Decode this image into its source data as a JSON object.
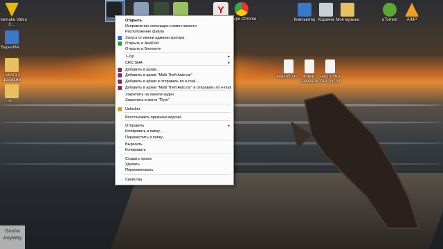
{
  "desktop_icons": [
    {
      "label": "Freemake Video C...",
      "color": "#e8b800"
    },
    {
      "label": "ВидеоМА...",
      "color": "#3a78c9"
    },
    {
      "label": "Работа с файлами",
      "color": "#e8c060"
    },
    {
      "label": "Ф...",
      "color": "#e8c060"
    }
  ],
  "top_icons": [
    {
      "label": "",
      "color": "#222222"
    },
    {
      "label": "",
      "color": "#8aa0b8"
    },
    {
      "label": "",
      "color": "#3a4a3a"
    },
    {
      "label": "",
      "color": "#9ac060"
    },
    {
      "label": "",
      "color": "#e8e8e8"
    },
    {
      "label": "Google Chrome",
      "color": "#3aa845"
    }
  ],
  "right_icons": [
    {
      "label": "Компьютер",
      "color": "#3a78c9"
    },
    {
      "label": "Корзина",
      "color": "#c8d0d8"
    },
    {
      "label": "Моя музыка",
      "color": "#e8c060"
    },
    {
      "label": "uTorrent",
      "color": "#5aa830"
    },
    {
      "label": "AIMP",
      "color": "#f0a020"
    }
  ],
  "files": [
    {
      "label": "видеоболо..."
    },
    {
      "label": "иконки с лазера.txt"
    },
    {
      "label": "настройка быстро.txt"
    }
  ],
  "context_menu": {
    "items": [
      {
        "label": "Открыть",
        "bold": true,
        "icon": "",
        "arrow": ""
      },
      {
        "label": "Исправление неполадок совместимости",
        "bold": false,
        "icon": "",
        "arrow": ""
      },
      {
        "label": "Расположение файла",
        "bold": false,
        "icon": "",
        "arrow": ""
      },
      {
        "label": "Запуск от имени администратора",
        "bold": false,
        "icon": "shield-icon",
        "arrow": ""
      },
      {
        "label": "Открыть в AkelPad",
        "bold": false,
        "icon": "akelpad-icon",
        "arrow": ""
      },
      {
        "label": "Открыть в Блокноте",
        "bold": false,
        "icon": "",
        "arrow": ""
      },
      {
        "label": "7-Zip",
        "bold": false,
        "icon": "",
        "arrow": "▸"
      },
      {
        "label": "CRC SHA",
        "bold": false,
        "icon": "",
        "arrow": "▸"
      },
      {
        "label": "Добавить в архив...",
        "bold": false,
        "icon": "winrar-icon",
        "arrow": ""
      },
      {
        "label": "Добавить в архив \"Multi Theft Auto.rar\"",
        "bold": false,
        "icon": "winrar-icon",
        "arrow": ""
      },
      {
        "label": "Добавить в архив и отправить по e-mail...",
        "bold": false,
        "icon": "winrar-icon",
        "arrow": ""
      },
      {
        "label": "Добавить в архив \"Multi Theft Auto.rar\" и отправить по e-mail",
        "bold": false,
        "icon": "winrar-icon",
        "arrow": ""
      },
      {
        "label": "Закрепить на панели задач",
        "bold": false,
        "icon": "",
        "arrow": ""
      },
      {
        "label": "Закрепить в меню \"Пуск\"",
        "bold": false,
        "icon": "",
        "arrow": ""
      },
      {
        "label": "Unlocker",
        "bold": false,
        "icon": "unlocker-icon",
        "arrow": ""
      },
      {
        "label": "Восстановить прежнюю версию",
        "bold": false,
        "icon": "",
        "arrow": ""
      },
      {
        "label": "Отправить",
        "bold": false,
        "icon": "",
        "arrow": "▸"
      },
      {
        "label": "Копировать в папку...",
        "bold": false,
        "icon": "",
        "arrow": ""
      },
      {
        "label": "Переместить в папку...",
        "bold": false,
        "icon": "",
        "arrow": ""
      },
      {
        "label": "Вырезать",
        "bold": false,
        "icon": "",
        "arrow": ""
      },
      {
        "label": "Копировать",
        "bold": false,
        "icon": "",
        "arrow": ""
      },
      {
        "label": "Создать ярлык",
        "bold": false,
        "icon": "",
        "arrow": ""
      },
      {
        "label": "Удалить",
        "bold": false,
        "icon": "",
        "arrow": ""
      },
      {
        "label": "Переименовать",
        "bold": false,
        "icon": "",
        "arrow": ""
      },
      {
        "label": "Свойства",
        "bold": false,
        "icon": "",
        "arrow": ""
      }
    ]
  },
  "watermark": {
    "line1": "Gosha",
    "line2": "AnyWay"
  }
}
